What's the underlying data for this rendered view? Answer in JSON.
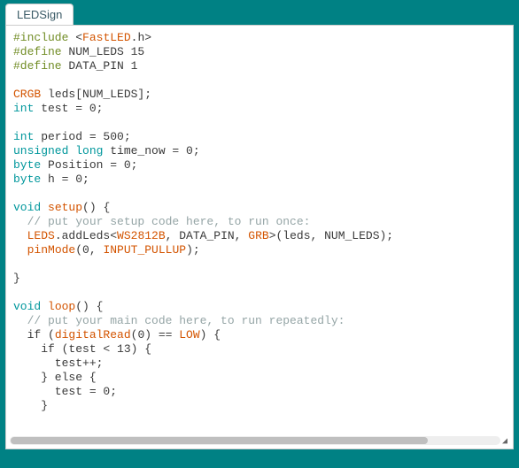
{
  "tab": {
    "title": "LEDSign"
  },
  "code": {
    "l1a": "#include",
    "l1b": "<",
    "l1c": "FastLED",
    "l1d": ".h>",
    "l2a": "#define",
    "l2b": " NUM_LEDS 15",
    "l3a": "#define",
    "l3b": " DATA_PIN 1",
    "l5a": "CRGB",
    "l5b": " leds[NUM_LEDS];",
    "l6a": "int",
    "l6b": " test = 0;",
    "l8a": "int",
    "l8b": " period = 500;",
    "l9a": "unsigned long",
    "l9b": " time_now = 0;",
    "l10a": "byte",
    "l10b": " Position = 0;",
    "l11a": "byte",
    "l11b": " h = 0;",
    "l13a": "void",
    "l13b": " ",
    "l13c": "setup",
    "l13d": "() {",
    "l14": "  // put your setup code here, to run once:",
    "l15a": "  ",
    "l15b": "LEDS",
    "l15c": ".addLeds<",
    "l15d": "WS2812B",
    "l15e": ", DATA_PIN, ",
    "l15f": "GRB",
    "l15g": ">(leds, NUM_LEDS);",
    "l16a": "  ",
    "l16b": "pinMode",
    "l16c": "(0, ",
    "l16d": "INPUT_PULLUP",
    "l16e": ");",
    "l18": "}",
    "l20a": "void",
    "l20b": " ",
    "l20c": "loop",
    "l20d": "() {",
    "l21": "  // put your main code here, to run repeatedly:",
    "l22a": "  if (",
    "l22b": "digitalRead",
    "l22c": "(0) == ",
    "l22d": "LOW",
    "l22e": ") {",
    "l23": "    if (test < 13) {",
    "l24": "      test++;",
    "l25": "    } else {",
    "l26": "      test = 0;",
    "l27": "    }"
  }
}
